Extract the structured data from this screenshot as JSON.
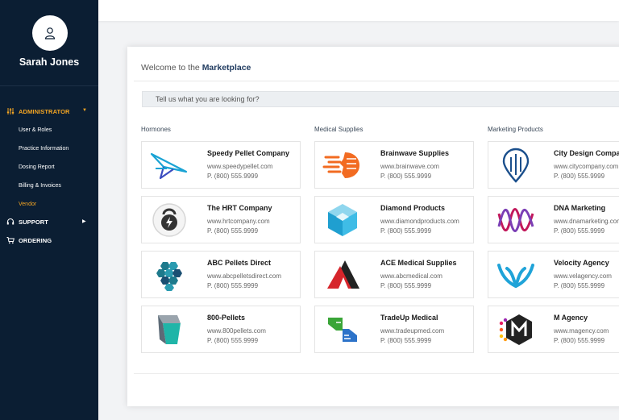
{
  "user": {
    "name": "Sarah Jones"
  },
  "nav": {
    "administrator": "ADMINISTRATOR",
    "sub": {
      "users": "User & Roles",
      "practice": "Practice Information",
      "dosing": "Dosing Report",
      "billing": "Billing & Invoices",
      "vendor": "Vendor"
    },
    "support": "SUPPORT",
    "ordering": "ORDERING"
  },
  "main": {
    "welcome_prefix": "Welcome to the",
    "welcome_strong": "Marketplace",
    "search_placeholder": "Tell us what you are looking for?"
  },
  "columns": [
    {
      "heading": "Hormones",
      "vendors": [
        {
          "name": "Speedy Pellet Company",
          "url": "www.speedypellet.com",
          "phone": "P. (800) 555.9999",
          "icon": "paper-plane-logo"
        },
        {
          "name": "The HRT Company",
          "url": "www.hrtcompany.com",
          "phone": "P. (800) 555.9999",
          "icon": "kettlebell-logo"
        },
        {
          "name": "ABC Pellets Direct",
          "url": "www.abcpelletsdirect.com",
          "phone": "P. (800) 555.9999",
          "icon": "hex-head-logo"
        },
        {
          "name": "800-Pellets",
          "url": "www.800pellets.com",
          "phone": "P. (800) 555.9999",
          "icon": "folded-shape-logo"
        }
      ]
    },
    {
      "heading": "Medical Supplies",
      "vendors": [
        {
          "name": "Brainwave Supplies",
          "url": "www.brainwave.com",
          "phone": "P. (800) 555.9999",
          "icon": "speed-head-logo"
        },
        {
          "name": "Diamond Products",
          "url": "www.diamondproducts.com",
          "phone": "P. (800) 555.9999",
          "icon": "cube-logo"
        },
        {
          "name": "ACE Medical Supplies",
          "url": "www.abcmedical.com",
          "phone": "P. (800) 555.9999",
          "icon": "triangle-a-logo"
        },
        {
          "name": "TradeUp Medical",
          "url": "www.tradeupmed.com",
          "phone": "P. (800) 555.9999",
          "icon": "handshake-logo"
        }
      ]
    },
    {
      "heading": "Marketing Products",
      "vendors": [
        {
          "name": "City Design Company",
          "url": "www.citycompany.com",
          "phone": "P. (800) 555.9999",
          "icon": "city-pin-logo"
        },
        {
          "name": "DNA Marketing",
          "url": "www.dnamarketing.com",
          "phone": "P. (800) 555.9999",
          "icon": "dna-wave-logo"
        },
        {
          "name": "Velocity Agency",
          "url": "www.velagency.com",
          "phone": "P. (800) 555.9999",
          "icon": "wings-logo"
        },
        {
          "name": "M Agency",
          "url": "www.magency.com",
          "phone": "P. (800) 555.9999",
          "icon": "m-hexagon-logo"
        }
      ]
    }
  ],
  "colors": {
    "sidebar": "#0b1e33",
    "accent": "#f5a623",
    "title": "#1f3a5f"
  }
}
